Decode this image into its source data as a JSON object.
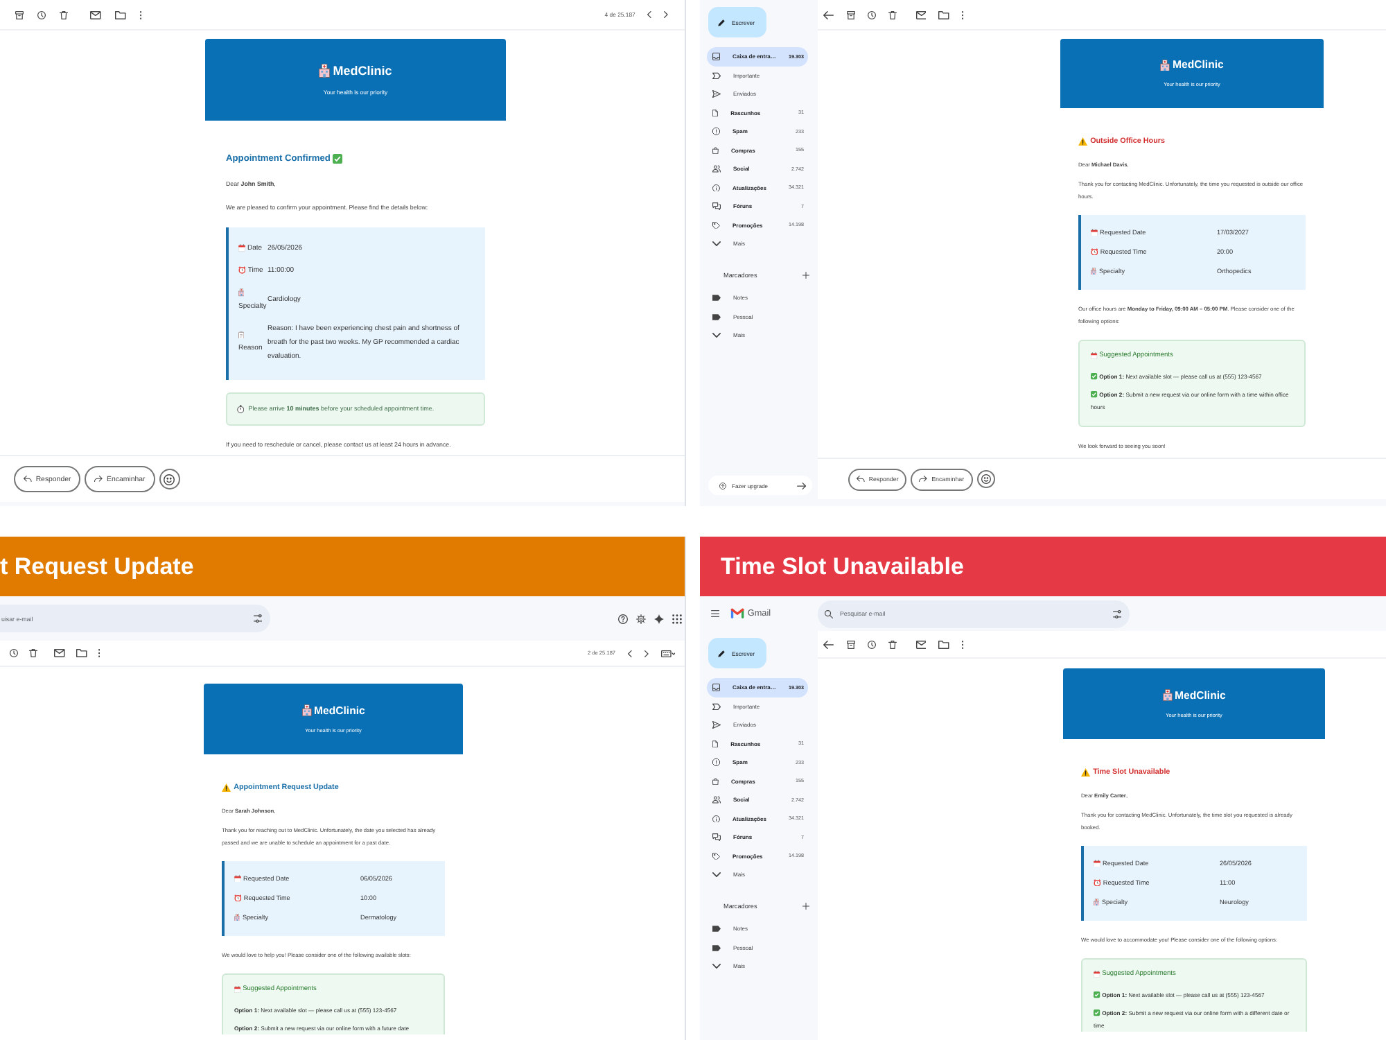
{
  "panels": [
    {
      "toolbar": {
        "counter": "4 de 25.187"
      },
      "email": {
        "brand": "MedClinic",
        "tagline": "Your health is our priority",
        "kind": "confirmation",
        "color": "#1a6fa8",
        "title": "Appointment Confirmed",
        "blocks": [
          {
            "kind": "text",
            "text": "Dear **John Smith**,"
          },
          {
            "kind": "text",
            "text": "We are pleased to confirm your appointment. Please find the details below:"
          },
          {
            "kind": "details",
            "rows": [
              {
                "label": "Date",
                "value": "26/05/2026"
              },
              {
                "label": "Time",
                "value": "11:00:00"
              },
              {
                "label": "Specialty",
                "value": "Cardiology"
              },
              {
                "label": "Reason",
                "value": "Reason: I have been experiencing chest pain and shortness of breath for the past two weeks. My GP recommended a cardiac evaluation."
              }
            ]
          },
          {
            "kind": "notice",
            "text": "Please arrive **10 minutes** before your scheduled appointment time."
          },
          {
            "kind": "text",
            "text": "If you need to reschedule or cancel, please contact us at least 24 hours in advance."
          }
        ]
      },
      "reply_actions": [
        "Responder",
        "Encaminhar"
      ]
    },
    {
      "sidebar": {
        "compose": "Escrever",
        "folders": [
          {
            "label": "Caixa de entra…",
            "count": "19.303",
            "selected": true
          },
          {
            "label": "Importante",
            "selected": false
          },
          {
            "label": "Enviados",
            "selected": false
          },
          {
            "label": "Rascunhos",
            "count": "31",
            "selected": false
          },
          {
            "label": "Spam",
            "count": "233",
            "selected": false
          },
          {
            "label": "Compras",
            "count": "155",
            "selected": false
          },
          {
            "label": "Social",
            "count": "2.742",
            "selected": false
          },
          {
            "label": "Atualizações",
            "count": "34.321",
            "selected": false
          },
          {
            "label": "Fóruns",
            "count": "7",
            "selected": false
          },
          {
            "label": "Promoções",
            "count": "14.198",
            "selected": false
          },
          {
            "label": "Mais",
            "selected": false
          }
        ],
        "labels_heading": "Marcadores",
        "labels": [
          {
            "label": "Notes",
            "selected": false
          },
          {
            "label": "Pessoal",
            "selected": false
          },
          {
            "label": "Mais",
            "selected": false
          }
        ],
        "upgrade": "Fazer upgrade"
      },
      "email": {
        "brand": "MedClinic",
        "tagline": "Your health is our priority",
        "kind": "notice",
        "color": "#d32f2f",
        "title": "Outside Office Hours",
        "blocks": [
          {
            "kind": "text",
            "text": "Dear **Michael Davis**,"
          },
          {
            "kind": "text",
            "text": "Thank you for contacting MedClinic. Unfortunately, the time you requested is outside our office hours."
          },
          {
            "kind": "details",
            "rows": [
              {
                "label": "Requested Date",
                "value": "17/03/2027"
              },
              {
                "label": "Requested Time",
                "value": "20:00"
              },
              {
                "label": "Specialty",
                "value": "Orthopedics"
              }
            ]
          },
          {
            "kind": "text",
            "text": "Our office hours are **Monday to Friday, 09:00 AM – 05:00 PM**. Please consider one of the following options:"
          },
          {
            "kind": "suggestions",
            "title": "Suggested Appointments",
            "options": [
              {
                "text": "**Option 1:** Next available slot — please call us at (555) 123-4567",
                "checked": true
              },
              {
                "text": "**Option 2:** Submit a new request via our online form with a time within office hours",
                "checked": true
              }
            ]
          },
          {
            "kind": "text",
            "text": "We look forward to seeing you soon!"
          }
        ]
      },
      "reply_actions": [
        "Responder",
        "Encaminhar"
      ]
    },
    {
      "banner": {
        "title": "t Request Update",
        "color": "#e07b00"
      },
      "search": {
        "placeholder": "uisar e-mail"
      },
      "toolbar": {
        "counter": "2 de 25.187"
      },
      "email": {
        "brand": "MedClinic",
        "tagline": "Your health is our priority",
        "kind": "notice",
        "color": "#1a6fa8",
        "title": "Appointment Request Update",
        "blocks": [
          {
            "kind": "text",
            "text": "Dear **Sarah Johnson**,"
          },
          {
            "kind": "text",
            "text": "Thank you for reaching out to MedClinic. Unfortunately, the date you selected has already passed and we are unable to schedule an appointment for a past date."
          },
          {
            "kind": "details",
            "rows": [
              {
                "label": "Requested Date",
                "value": "06/05/2026"
              },
              {
                "label": "Requested Time",
                "value": "10:00"
              },
              {
                "label": "Specialty",
                "value": "Dermatology"
              }
            ]
          },
          {
            "kind": "text",
            "text": "We would love to help you! Please consider one of the following available slots:"
          },
          {
            "kind": "suggestions",
            "title": "Suggested Appointments",
            "options": [
              {
                "text": "**Option 1:** Next available slot — please call us at (555) 123-4567",
                "checked": false
              },
              {
                "text": "**Option 2:** Submit a new request via our online form with a future date",
                "checked": false
              }
            ]
          }
        ]
      }
    },
    {
      "banner": {
        "title": "Time Slot Unavailable",
        "color": "#e63946"
      },
      "sidebar": {
        "logo": "Gmail",
        "compose": "Escrever",
        "folders": [
          {
            "label": "Caixa de entra…",
            "count": "19.303",
            "selected": true
          },
          {
            "label": "Importante",
            "selected": false
          },
          {
            "label": "Enviados",
            "selected": false
          },
          {
            "label": "Rascunhos",
            "count": "31",
            "selected": false
          },
          {
            "label": "Spam",
            "count": "233",
            "selected": false
          },
          {
            "label": "Compras",
            "count": "155",
            "selected": false
          },
          {
            "label": "Social",
            "count": "2.742",
            "selected": false
          },
          {
            "label": "Atualizações",
            "count": "34.321",
            "selected": false
          },
          {
            "label": "Fóruns",
            "count": "7",
            "selected": false
          },
          {
            "label": "Promoções",
            "count": "14.198",
            "selected": false
          },
          {
            "label": "Mais",
            "selected": false
          }
        ],
        "labels_heading": "Marcadores",
        "labels": [
          {
            "label": "Notes",
            "selected": false
          },
          {
            "label": "Pessoal",
            "selected": false
          },
          {
            "label": "Mais",
            "selected": false
          }
        ]
      },
      "search": {
        "placeholder": "Pesquisar e-mail"
      },
      "email": {
        "brand": "MedClinic",
        "tagline": "Your health is our priority",
        "kind": "notice",
        "color": "#d32f2f",
        "title": "Time Slot Unavailable",
        "blocks": [
          {
            "kind": "text",
            "text": "Dear **Emily Carter**,"
          },
          {
            "kind": "text",
            "text": "Thank you for contacting MedClinic. Unfortunately, the time slot you requested is already booked."
          },
          {
            "kind": "details",
            "rows": [
              {
                "label": "Requested Date",
                "value": "26/05/2026"
              },
              {
                "label": "Requested Time",
                "value": "11:00"
              },
              {
                "label": "Specialty",
                "value": "Neurology"
              }
            ]
          },
          {
            "kind": "text",
            "text": "We would love to accommodate you! Please consider one of the following options:"
          },
          {
            "kind": "suggestions",
            "title": "Suggested Appointments",
            "options": [
              {
                "text": "**Option 1:** Next available slot — please call us at (555) 123-4567",
                "checked": true
              },
              {
                "text": "**Option 2:** Submit a new request via our online form with a different date or time",
                "checked": true
              }
            ]
          }
        ]
      }
    }
  ]
}
